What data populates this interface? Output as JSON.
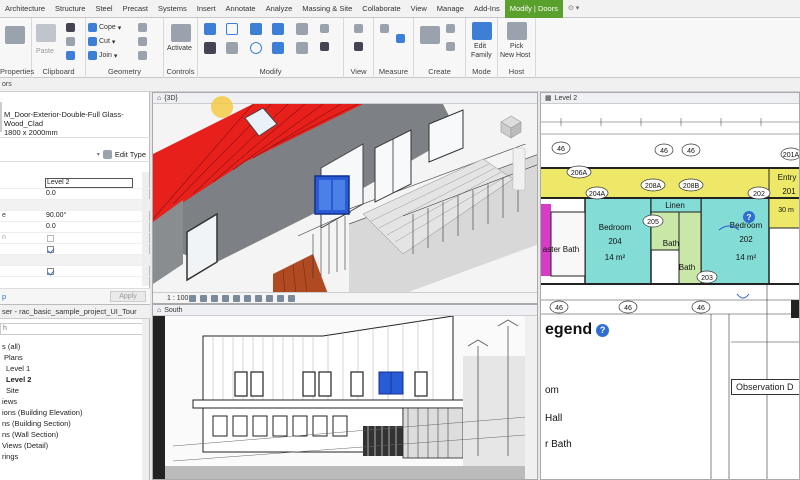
{
  "ribbon": {
    "tabs": [
      "Architecture",
      "Structure",
      "Steel",
      "Precast",
      "Systems",
      "Insert",
      "Annotate",
      "Analyze",
      "Massing & Site",
      "Collaborate",
      "View",
      "Manage",
      "Add-Ins",
      "Modify | Doors"
    ],
    "active_tab": "Modify | Doors",
    "groups": {
      "properties": "Properties",
      "clipboard": "Clipboard",
      "geometry": "Geometry",
      "controls": "Controls",
      "modify": "Modify",
      "view": "View",
      "measure": "Measure",
      "create": "Create",
      "mode": "Mode",
      "host": "Host"
    },
    "buttons": {
      "paste": "Paste",
      "cope": "Cope",
      "cut": "Cut",
      "join": "Join",
      "activate": "Activate",
      "edit_family_1": "Edit",
      "edit_family_2": "Family",
      "pick_host_1": "Pick",
      "pick_host_2": "New Host"
    },
    "options_bar": "ors"
  },
  "properties": {
    "type_line1": "M_Door-Exterior-Double-Full Glass-",
    "type_line2": "Wood_Clad",
    "type_line3": "1800 x 2000mm",
    "edit_type": "Edit Type",
    "rows": [
      {
        "key": "",
        "value": "Level 2",
        "kind": "input"
      },
      {
        "key": "",
        "value": "0.0",
        "kind": "text"
      },
      {
        "key": "",
        "value": "",
        "kind": "blank"
      },
      {
        "key": "e",
        "value": "90.00°",
        "kind": "text"
      },
      {
        "key": "",
        "value": "0.0",
        "kind": "text"
      },
      {
        "key": "n",
        "value": "",
        "kind": "check-dim"
      },
      {
        "key": "",
        "value": "",
        "kind": "check"
      },
      {
        "key": "",
        "value": "",
        "kind": "blank"
      },
      {
        "key": "",
        "value": "",
        "kind": "check"
      }
    ],
    "link": "p",
    "apply": "Apply"
  },
  "browser": {
    "title": "ser - rac_basic_sample_project_UI_Tour",
    "search": "h",
    "items": [
      "s (all)",
      "Plans",
      "Level 1",
      "Level 2",
      "Site",
      "iews",
      "ions (Building Elevation)",
      "ns (Building Section)",
      "ns (Wall Section)",
      "Views (Detail)",
      "rings"
    ]
  },
  "vp3d": {
    "title": "{3D}",
    "scale": "1 : 100"
  },
  "vpSouth": {
    "title": "South"
  },
  "vpLevel2": {
    "title": "Level 2",
    "rooms": {
      "bedroom1": "Bedroom",
      "bedroom1_num": "204",
      "bedroom1_area": "14 m²",
      "bedroom2": "Bedroom",
      "bedroom2_num": "202",
      "bedroom2_area": "14 m²",
      "linen": "Linen",
      "bath1": "Bath",
      "bath2": "Bath",
      "master_bath": "aster Bath",
      "entry": "Entry",
      "entry_num": "201"
    },
    "tags": [
      "46",
      "46",
      "46",
      "206A",
      "204A",
      "208A",
      "208B",
      "202",
      "205",
      "203",
      "201A",
      "30 m",
      "46",
      "46",
      "46"
    ],
    "legend": {
      "title": "egend",
      "items": [
        "om",
        "Hall",
        "r Bath"
      ],
      "observation": "Observation D"
    }
  },
  "colors": {
    "roof": "#e8201c",
    "accent": "#5aa02c",
    "room_yellow": "#ede868",
    "room_teal": "#84dcd6",
    "room_magenta": "#d63cc6",
    "room_green": "#c9e8a8",
    "selected_door": "#2a5bd7"
  }
}
